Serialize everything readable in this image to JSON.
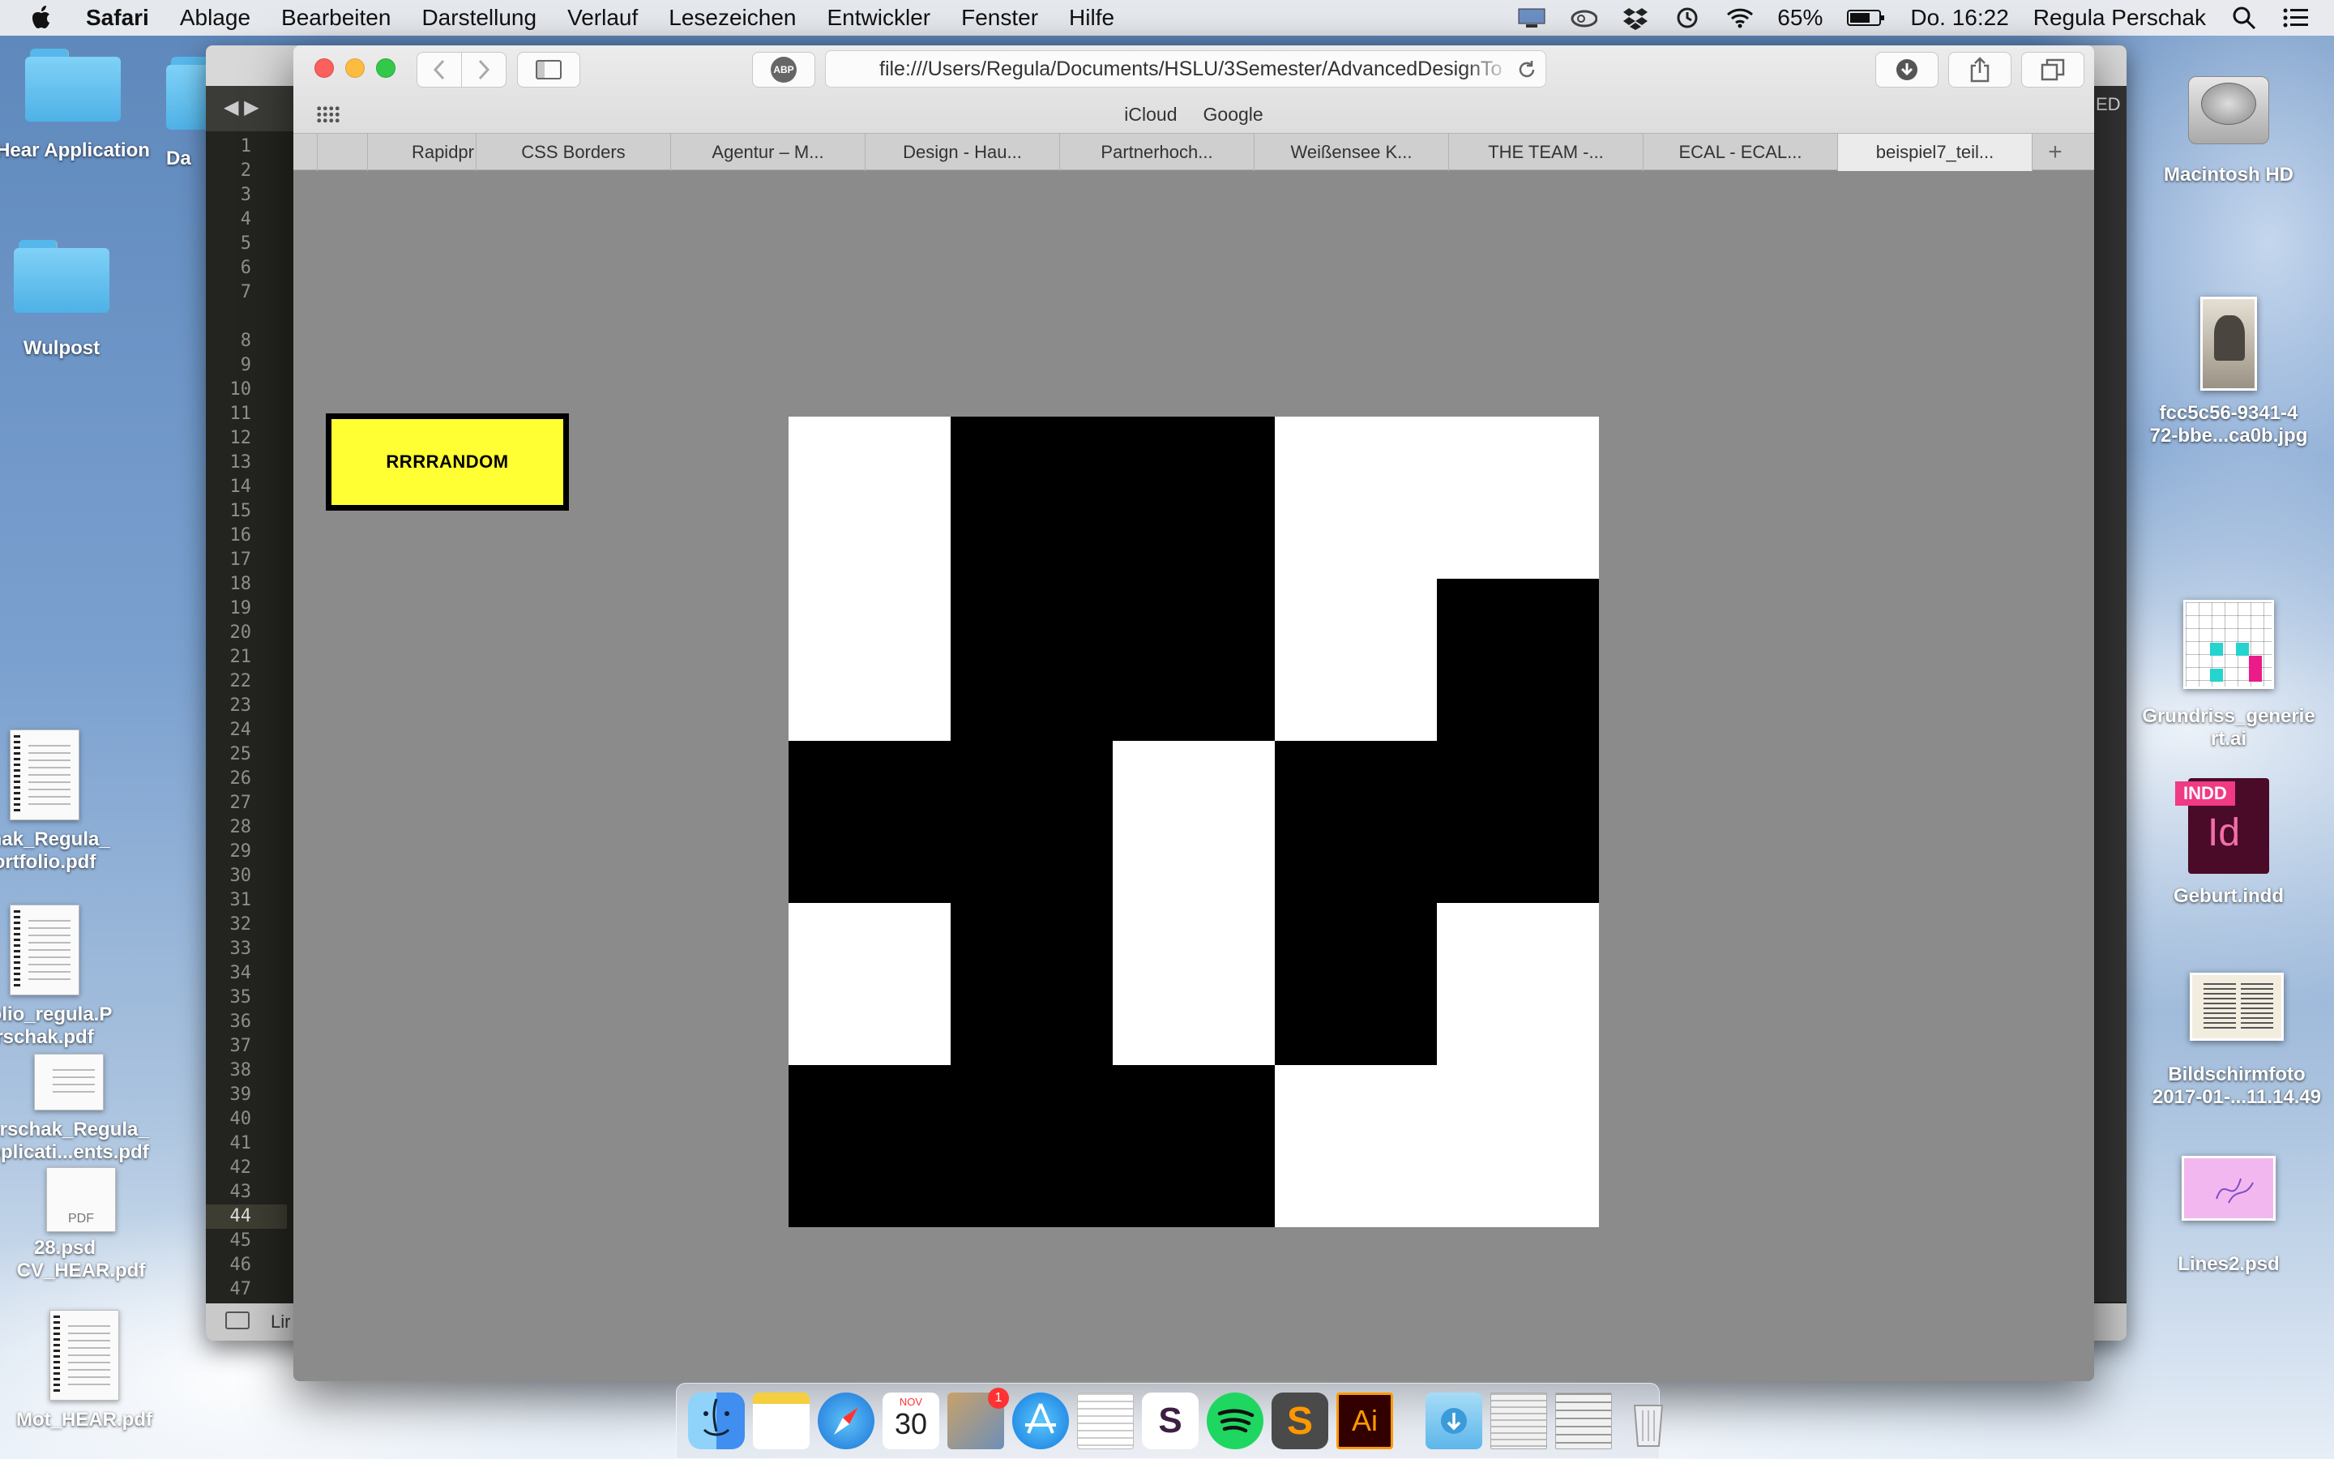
{
  "menubar": {
    "app_name": "Safari",
    "items": [
      "Ablage",
      "Bearbeiten",
      "Darstellung",
      "Verlauf",
      "Lesezeichen",
      "Entwickler",
      "Fenster",
      "Hilfe"
    ],
    "battery": "65%",
    "clock": "Do. 16:22",
    "user": "Regula Perschak"
  },
  "desktop": {
    "left_icons": [
      {
        "label": "Hear Application"
      },
      {
        "label": "Da"
      },
      {
        "label": "Wulpost"
      },
      {
        "label1": "chak_Regula_",
        "label2": "ortfolio.pdf"
      },
      {
        "label1": "tfolio_regula.P",
        "label2": "rschak.pdf"
      },
      {
        "label1": "erschak_Regula_",
        "label2": "pplicati...ents.pdf"
      },
      {
        "label1": "28.psd",
        "label2": "CV_HEAR.pdf",
        "doc_type": "PDF"
      },
      {
        "label": "Mot_HEAR.pdf"
      }
    ],
    "right_icons": [
      {
        "label": "Macintosh HD"
      },
      {
        "label1": "fcc5c56-9341-4",
        "label2": "72-bbe...ca0b.jpg"
      },
      {
        "label1": "Grundriss_generie",
        "label2": "rt.ai"
      },
      {
        "label": "Geburt.indd",
        "badge": "INDD",
        "glyph": "Id"
      },
      {
        "label1": "Bildschirmfoto",
        "label2": "2017-01-...11.14.49"
      },
      {
        "label": "Lines2.psd"
      }
    ],
    "editor_edge_label": "ED"
  },
  "editor": {
    "line_numbers": [
      "1",
      "2",
      "3",
      "4",
      "5",
      "6",
      "7",
      "",
      "8",
      "9",
      "10",
      "11",
      "12",
      "13",
      "14",
      "15",
      "16",
      "17",
      "18",
      "19",
      "20",
      "21",
      "22",
      "23",
      "24",
      "25",
      "26",
      "27",
      "28",
      "29",
      "30",
      "31",
      "32",
      "33",
      "34",
      "35",
      "36",
      "37",
      "38",
      "39",
      "40",
      "41",
      "42",
      "43",
      "44",
      "45",
      "46",
      "47"
    ],
    "active_line": "44",
    "status_label": "Lir"
  },
  "safari": {
    "url": "file:///Users/Regula/Documents/HSLU/3Semester/AdvancedDesignTo",
    "abp_label": "ABP",
    "favorites": [
      "iCloud",
      "Google"
    ],
    "tabs": [
      {
        "label": "",
        "active": false
      },
      {
        "label": "",
        "active": false
      },
      {
        "label": "Rapidpr",
        "active": false
      },
      {
        "label": "CSS Borders",
        "active": false
      },
      {
        "label": "Agentur – M...",
        "active": false
      },
      {
        "label": "Design - Hau...",
        "active": false
      },
      {
        "label": "Partnerhoch...",
        "active": false
      },
      {
        "label": "Weißensee K...",
        "active": false
      },
      {
        "label": "THE TEAM -...",
        "active": false
      },
      {
        "label": "ECAL - ECAL...",
        "active": false
      },
      {
        "label": "beispiel7_teil...",
        "active": true
      }
    ],
    "new_tab_label": "+"
  },
  "page": {
    "button_label": "RRRRANDOM",
    "background": "#8b8b8b",
    "button_color": "#ffff33",
    "grid": [
      [
        0,
        1,
        1,
        0,
        0
      ],
      [
        0,
        1,
        1,
        0,
        1
      ],
      [
        1,
        1,
        0,
        1,
        1
      ],
      [
        0,
        1,
        0,
        1,
        0
      ],
      [
        1,
        1,
        1,
        0,
        0
      ]
    ],
    "colors": {
      "0": "#ffffff",
      "1": "#000000"
    }
  },
  "dock": {
    "apps": [
      "finder",
      "notes",
      "safari",
      "calendar",
      "mail-photos",
      "app-store",
      "textedit",
      "slack",
      "spotify",
      "sublime-text",
      "illustrator",
      "downloads",
      "documents",
      "pdf-stack",
      "trash"
    ],
    "calendar_month": "NOV",
    "calendar_day": "30",
    "mail_badge": "1",
    "illustrator_glyph": "Ai",
    "sublime_glyph": "S"
  }
}
